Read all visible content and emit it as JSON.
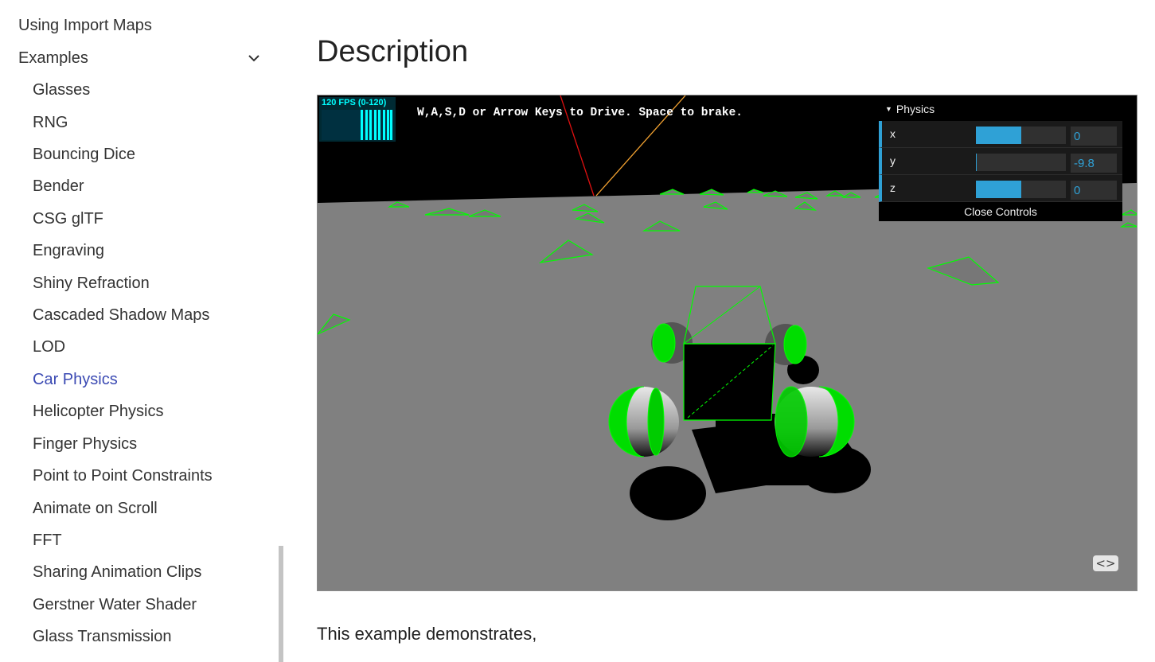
{
  "sidebar": {
    "top_link": "Using Import Maps",
    "section": "Examples",
    "items": [
      {
        "label": "Glasses"
      },
      {
        "label": "RNG"
      },
      {
        "label": "Bouncing Dice"
      },
      {
        "label": "Bender"
      },
      {
        "label": "CSG glTF"
      },
      {
        "label": "Engraving"
      },
      {
        "label": "Shiny Refraction"
      },
      {
        "label": "Cascaded Shadow Maps"
      },
      {
        "label": "LOD"
      },
      {
        "label": "Car Physics"
      },
      {
        "label": "Helicopter Physics"
      },
      {
        "label": "Finger Physics"
      },
      {
        "label": "Point to Point Constraints"
      },
      {
        "label": "Animate on Scroll"
      },
      {
        "label": "FFT"
      },
      {
        "label": "Sharing Animation Clips"
      },
      {
        "label": "Gerstner Water Shader"
      },
      {
        "label": "Glass Transmission"
      }
    ],
    "active_item": "Car Physics"
  },
  "main": {
    "title": "Description",
    "intro_text": "This example demonstrates,"
  },
  "viewport": {
    "instructions": "W,A,S,D or Arrow Keys to Drive. Space to brake.",
    "stats": {
      "label": "120 FPS (0-120)"
    },
    "gui": {
      "folder": "Physics",
      "controls": [
        {
          "name": "x",
          "value": "0",
          "fill": 0.5
        },
        {
          "name": "y",
          "value": "-9.8",
          "fill": 0.01
        },
        {
          "name": "z",
          "value": "0",
          "fill": 0.5
        }
      ],
      "close_label": "Close Controls"
    },
    "code_button": "<>"
  },
  "colors": {
    "accent": "#2fa1d6",
    "active_link": "#3b4ab3",
    "wireframe": "#00ff00",
    "ground": "#808080"
  }
}
